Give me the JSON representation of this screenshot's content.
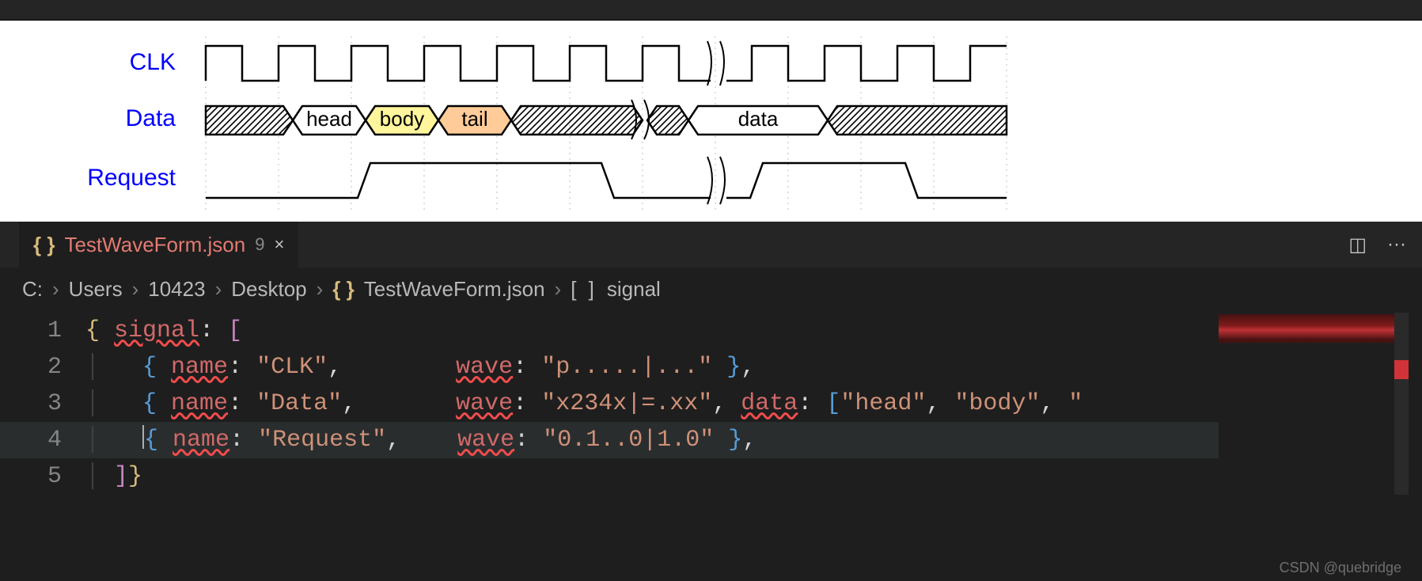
{
  "tab": {
    "file_name": "TestWaveForm.json",
    "badge": "9",
    "close": "×"
  },
  "breadcrumb": {
    "parts": [
      "C:",
      "Users",
      "10423",
      "Desktop"
    ],
    "file": "TestWaveForm.json",
    "node_icon": "[ ]",
    "node": "signal"
  },
  "waveform": {
    "signals": [
      "CLK",
      "Data",
      "Request"
    ],
    "data_labels": {
      "head": "head",
      "body": "body",
      "tail": "tail",
      "data": "data"
    }
  },
  "code": {
    "lines": {
      "l1": {
        "n": "1",
        "signal": "signal"
      },
      "l2": {
        "n": "2",
        "name_k": "name",
        "name_v": "\"CLK\"",
        "wave_k": "wave",
        "wave_v": "\"p.....|...\""
      },
      "l3": {
        "n": "3",
        "name_k": "name",
        "name_v": "\"Data\"",
        "wave_k": "wave",
        "wave_v": "\"x234x|=.xx\"",
        "data_k": "data",
        "data_a": "\"head\"",
        "data_b": "\"body\"",
        "data_c": "\""
      },
      "l4": {
        "n": "4",
        "name_k": "name",
        "name_v": "\"Request\"",
        "wave_k": "wave",
        "wave_v": "\"0.1..0|1.0\""
      },
      "l5": {
        "n": "5"
      }
    }
  },
  "watermark": "CSDN @quebridge",
  "icons": {
    "split": "◫",
    "more": "···",
    "chevron": "›"
  },
  "chart_data": {
    "type": "timing-diagram",
    "signals": [
      {
        "name": "CLK",
        "wave": "p.....|..."
      },
      {
        "name": "Data",
        "wave": "x234x|=.xx",
        "data": [
          "head",
          "body",
          "tail",
          "data"
        ]
      },
      {
        "name": "Request",
        "wave": "0.1..0|1.0"
      }
    ]
  }
}
